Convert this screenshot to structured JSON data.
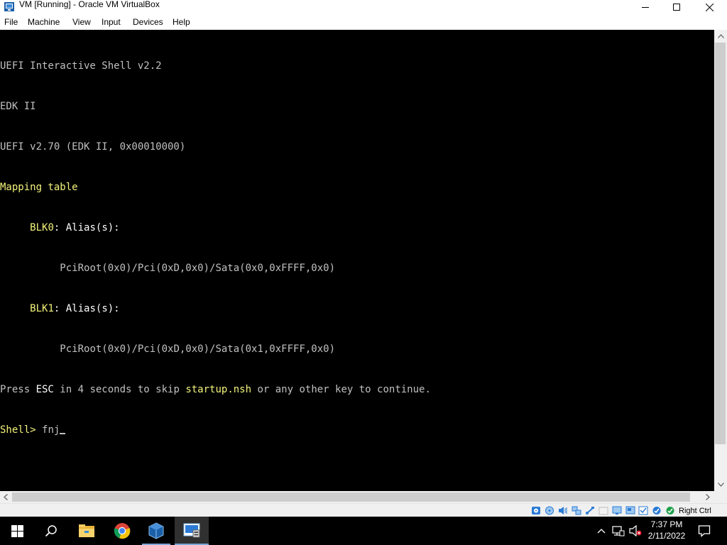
{
  "window": {
    "title": "VM [Running] - Oracle VM VirtualBox",
    "icon": "virtualbox-icon",
    "controls": [
      "minimize-icon",
      "maximize-icon",
      "close-icon"
    ]
  },
  "menu": {
    "items": [
      {
        "label": "File"
      },
      {
        "label": "Machine"
      },
      {
        "label": "View"
      },
      {
        "label": "Input"
      },
      {
        "label": "Devices"
      },
      {
        "label": "Help"
      }
    ]
  },
  "terminal": {
    "line1": "UEFI Interactive Shell v2.2",
    "line2": "EDK II",
    "line3": "UEFI v2.70 (EDK II, 0x00010000)",
    "line4": "Mapping table",
    "blk0_name": "BLK0",
    "blk0_sep": ":",
    "blk0_alias": "Alias(s):",
    "blk0_path": "PciRoot(0x0)/Pci(0xD,0x0)/Sata(0x0,0xFFFF,0x0)",
    "blk1_name": "BLK1",
    "blk1_sep": ":",
    "blk1_alias": "Alias(s):",
    "blk1_path": "PciRoot(0x0)/Pci(0xD,0x0)/Sata(0x1,0xFFFF,0x0)",
    "press": "Press ",
    "esc": "ESC",
    "in_seconds": " in 4 seconds to skip ",
    "startup": "startup.nsh",
    "continue": " or any other key to continue.",
    "prompt": "Shell> ",
    "input": "fnj"
  },
  "statusbar": {
    "icons": [
      "hard-disk-icon",
      "optical-drive-icon",
      "audio-icon",
      "network-icon",
      "usb-icon",
      "shared-folders-icon",
      "display-icon",
      "recording-icon",
      "cpu-icon",
      "mouse-integration-icon",
      "keyboard-capture-icon"
    ],
    "host_key": "Right Ctrl"
  },
  "taskbar": {
    "items": [
      "windows-start-icon",
      "search-icon",
      "file-explorer-icon",
      "chrome-icon",
      "virtualbox-icon",
      "vm-window-icon"
    ],
    "tray_icons": [
      "chevron-up-icon",
      "network-tray-icon",
      "volume-muted-icon"
    ],
    "time": "7:37 PM",
    "date": "2/11/2022",
    "notification_icon": "action-center-icon"
  },
  "colors": {
    "terminal_bg": "#000000",
    "terminal_text": "#c0c0c0",
    "terminal_highlight": "#f4f47a",
    "terminal_white": "#ffffff"
  }
}
